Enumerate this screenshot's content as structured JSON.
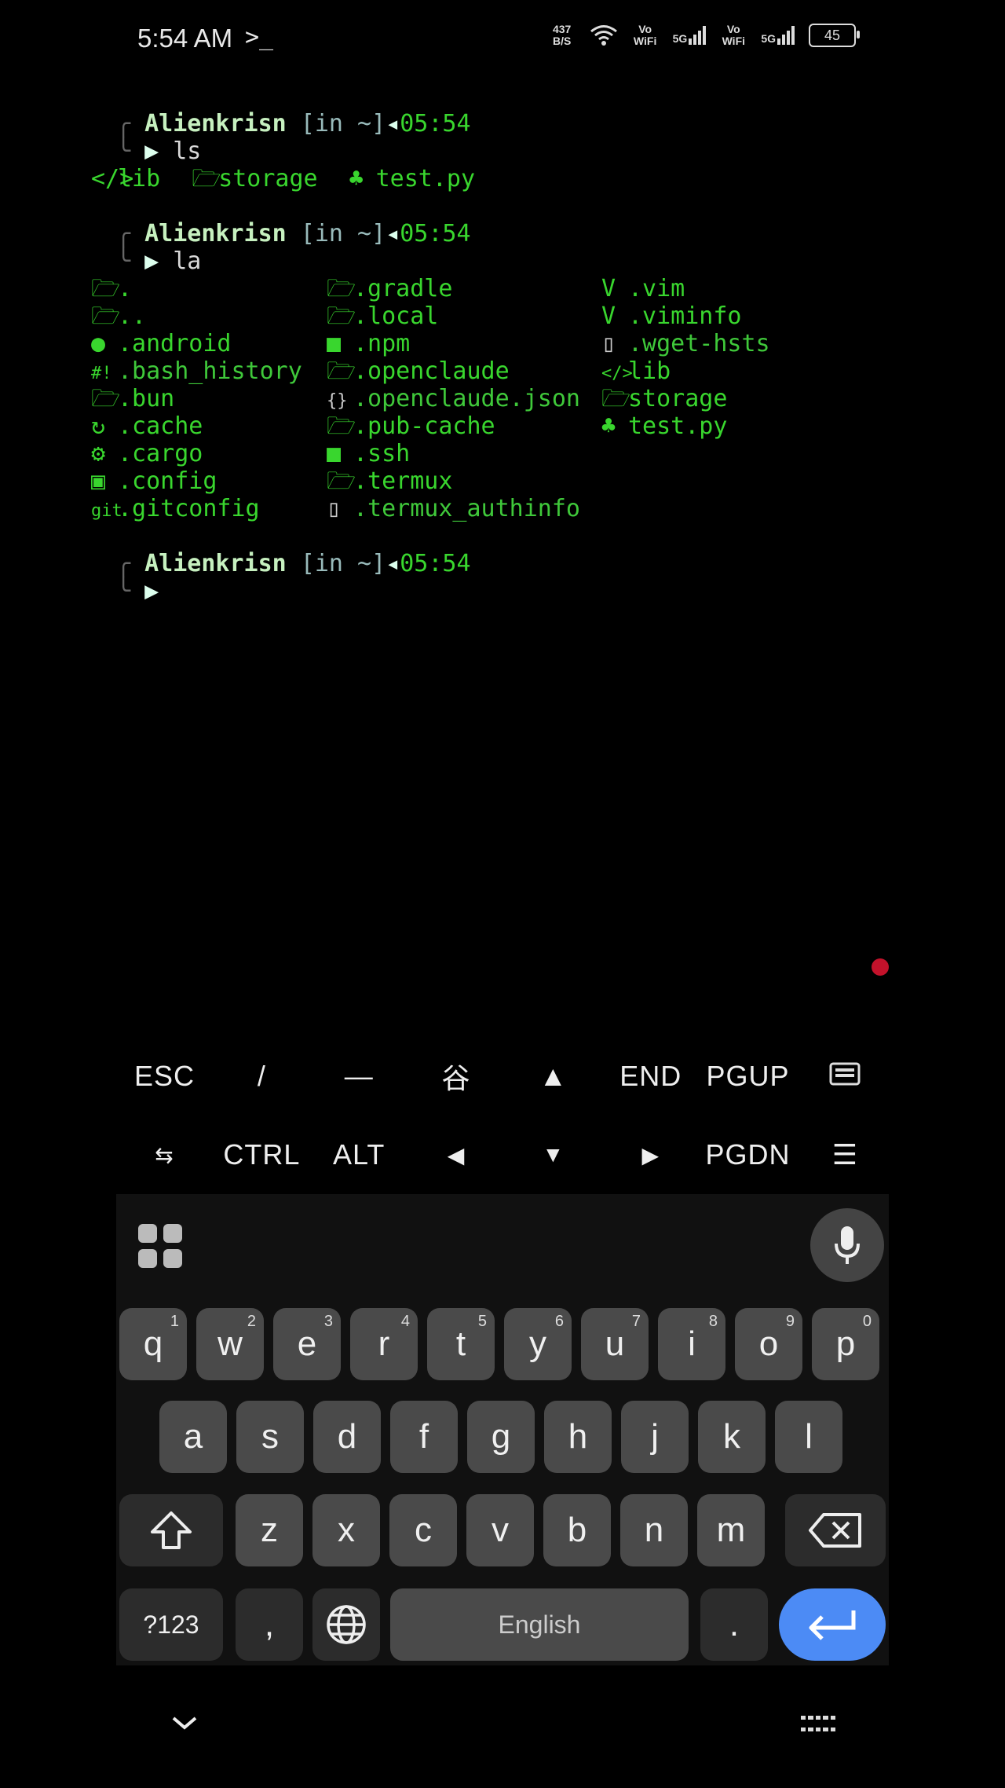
{
  "status_bar": {
    "time": "5:54 AM",
    "prompt_glyph": ">_",
    "net_speed": "437 B/S",
    "vo_wifi_1": "Vo WiFi",
    "sig_1": "5G",
    "vo_wifi_2": "Vo WiFi",
    "sig_2": "5G",
    "battery": "45"
  },
  "terminal": {
    "prompt_user": "Alienkrisn",
    "prompt_dir": "[in ~]",
    "prompt_time": "05:54",
    "block1_cmd": "ls",
    "block1_items": [
      "lib",
      "storage",
      "test.py"
    ],
    "block2_cmd": "la",
    "block2_items": [
      ".",
      ".gradle",
      ".vim",
      "..",
      ".local",
      ".viminfo",
      ".android",
      ".npm",
      ".wget-hsts",
      ".bash_history",
      ".openclaude",
      "lib",
      ".bun",
      ".openclaude.json",
      "storage",
      ".cache",
      ".pub-cache",
      "test.py",
      ".cargo",
      ".ssh",
      "",
      ".config",
      ".termux",
      "",
      ".gitconfig",
      ".termux_authinfo",
      ""
    ],
    "block2_icons": [
      "folder-open-icon",
      "folder-open-icon",
      "vim-icon",
      "folder-open-icon",
      "folder-open-icon",
      "vim-icon",
      "android-icon",
      "folder-icon",
      "file-icon",
      "hash-icon",
      "folder-open-icon",
      "code-icon",
      "folder-open-icon",
      "json-icon",
      "folder-open-icon",
      "refresh-icon",
      "folder-open-icon",
      "python-icon",
      "rust-icon",
      "folder-icon",
      "",
      "gear-folder-icon",
      "folder-open-icon",
      "",
      "git-icon",
      "file-icon",
      ""
    ]
  },
  "extra_keys": {
    "row1": [
      "ESC",
      "/",
      "—",
      "谷",
      "▲",
      "END",
      "PGUP",
      "keyboard-icon"
    ],
    "row2": [
      "tab-icon",
      "CTRL",
      "ALT",
      "◀",
      "▼",
      "▶",
      "PGDN",
      "menu-icon"
    ]
  },
  "keyboard": {
    "row1": [
      "q",
      "w",
      "e",
      "r",
      "t",
      "y",
      "u",
      "i",
      "o",
      "p"
    ],
    "row1_nums": [
      "1",
      "2",
      "3",
      "4",
      "5",
      "6",
      "7",
      "8",
      "9",
      "0"
    ],
    "row2": [
      "a",
      "s",
      "d",
      "f",
      "g",
      "h",
      "j",
      "k",
      "l"
    ],
    "row3": [
      "z",
      "x",
      "c",
      "v",
      "b",
      "n",
      "m"
    ],
    "symbols_key": "?123",
    "comma_key": ",",
    "space_label": "English",
    "period_key": "."
  },
  "colors": {
    "terminal_green": "#39d62e",
    "enter_key": "#4c8bf5",
    "record_dot": "#c3122b"
  }
}
